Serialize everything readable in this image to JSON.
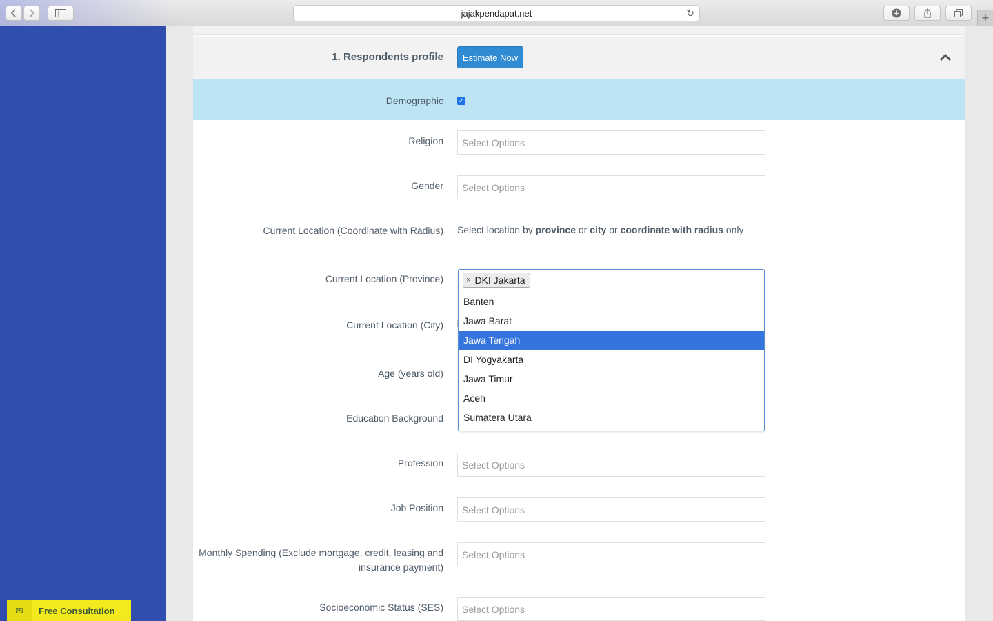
{
  "browser": {
    "url": "jajakpendapat.net",
    "back_icon": "chevron-left-icon",
    "forward_icon": "chevron-right-icon"
  },
  "section": {
    "title": "1. Respondents profile",
    "estimate_label": "Estimate Now"
  },
  "demographic": {
    "label": "Demographic",
    "checked": true
  },
  "fields": {
    "religion": {
      "label": "Religion",
      "placeholder": "Select Options"
    },
    "gender": {
      "label": "Gender",
      "placeholder": "Select Options"
    },
    "coord": {
      "label": "Current Location (Coordinate with Radius)"
    },
    "province": {
      "label": "Current Location (Province)"
    },
    "city": {
      "label": "Current Location (City)"
    },
    "age": {
      "label": "Age (years old)"
    },
    "education": {
      "label": "Education Background"
    },
    "profession": {
      "label": "Profession",
      "placeholder": "Select Options"
    },
    "job": {
      "label": "Job Position",
      "placeholder": "Select Options"
    },
    "spending": {
      "label_line1": "Monthly Spending (Exclude mortgage, credit, leasing and",
      "label_line2": "insurance payment)",
      "placeholder": "Select Options"
    },
    "ses": {
      "label": "Socioeconomic Status (SES)",
      "placeholder": "Select Options"
    }
  },
  "location_note": {
    "prefix": "Select location by",
    "province": "province",
    "or1": "or",
    "city": "city",
    "or2": "or",
    "coordinate": "coordinate with radius",
    "suffix": "only"
  },
  "province_select": {
    "selected_tag": "DKI Jakarta",
    "options": [
      "Banten",
      "Jawa Barat",
      "Jawa Tengah",
      "DI Yogyakarta",
      "Jawa Timur",
      "Aceh",
      "Sumatera Utara"
    ],
    "highlighted": "Jawa Tengah"
  },
  "consultation": {
    "label": "Free Consultation"
  },
  "colors": {
    "sidebar": "#2f4ead",
    "estimate": "#2f8bd3",
    "highlight": "#3574dd",
    "demographic_row": "#bde4f5",
    "consult": "#f3e91c"
  }
}
